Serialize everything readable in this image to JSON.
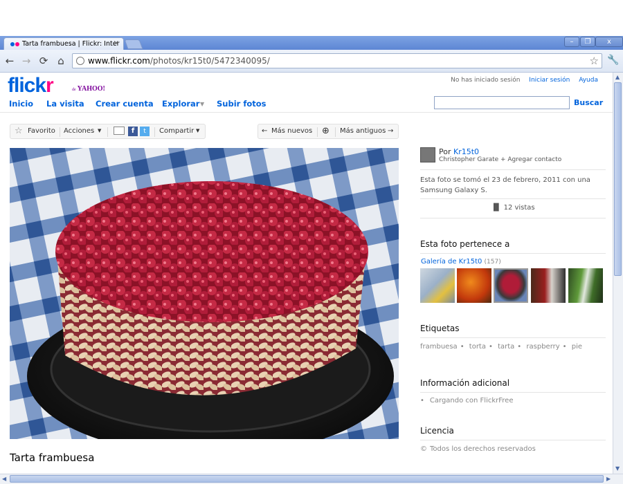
{
  "browser": {
    "tab_title": "Tarta frambuesa | Flickr: Inter",
    "tab_close": "×",
    "url_host": "www.flickr.com",
    "url_path": "/photos/kr15t0/5472340095/",
    "window_min": "–",
    "window_max": "❐",
    "window_close": "x"
  },
  "header": {
    "logo_part1": "flick",
    "logo_part2": "r",
    "yahoo_de": "de",
    "yahoo": "YAHOO!",
    "not_signed_in": "No has iniciado sesión",
    "sign_in": "Iniciar sesión",
    "help": "Ayuda",
    "nav": [
      "Inicio",
      "La visita",
      "Crear cuenta",
      "Explorar",
      "Subir fotos"
    ],
    "search_button": "Buscar",
    "search_value": ""
  },
  "photo_toolbar": {
    "favorite": "Favorito",
    "actions": "Acciones",
    "share": "Compartir",
    "newer": "Más nuevos",
    "older": "Más antiguos"
  },
  "photo": {
    "title": "Tarta frambuesa"
  },
  "sidebar": {
    "by": "Por",
    "owner_handle": "Kr15t0",
    "owner_name": "Christopher Garate",
    "add_contact": "+ Agregar contacto",
    "taken_info": "Esta foto se tomó el 23 de febrero, 2011 con una Samsung Galaxy S.",
    "views": "12 vistas",
    "belongs_heading": "Esta foto pertenece a",
    "gallery_label": "Galería de Kr15t0",
    "gallery_count": "(157)",
    "tags_heading": "Etiquetas",
    "tags": [
      "frambuesa",
      "torta",
      "tarta",
      "raspberry",
      "pie"
    ],
    "tag_separator": "•",
    "info_heading": "Información adicional",
    "info_item": "Cargando con FlickrFree",
    "license_heading": "Licencia",
    "license_text": "Todos los derechos reservados"
  },
  "colors": {
    "flickr_blue": "#0063dc",
    "flickr_pink": "#ff0084",
    "yahoo_purple": "#7b0099"
  }
}
